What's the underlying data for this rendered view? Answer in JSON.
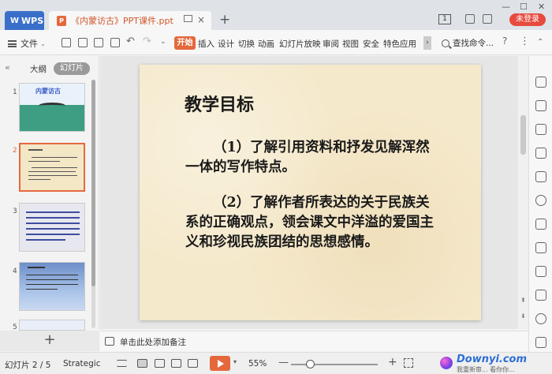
{
  "titlebar": {
    "app_tab": "WPS",
    "doc_title": "《内蒙访古》PPT课件.ppt",
    "badge": "1",
    "login": "未登录"
  },
  "ribbon": {
    "file": "文件",
    "start": "开始",
    "tabs": [
      "插入",
      "设计",
      "切换",
      "动画",
      "幻灯片放映",
      "审阅",
      "视图",
      "安全",
      "特色应用"
    ],
    "search": "查找命令..."
  },
  "left_panel": {
    "outline_tab": "大纲",
    "slides_tab": "幻灯片",
    "thumbnails": [
      {
        "num": "1",
        "title": "内蒙访古"
      },
      {
        "num": "2"
      },
      {
        "num": "3"
      },
      {
        "num": "4"
      },
      {
        "num": "5"
      }
    ],
    "add": "+"
  },
  "slide": {
    "title": "教学目标",
    "paragraphs": [
      "（1）了解引用资料和抒发见解浑然一体的写作特点。",
      "（2）了解作者所表达的关于民族关系的正确观点，领会课文中洋溢的爱国主义和珍视民族团结的思想感情。"
    ]
  },
  "notes": {
    "placeholder": "单击此处添加备注"
  },
  "status": {
    "page": "幻灯片 2 / 5",
    "theme": "Strategic",
    "zoom": "55%",
    "zoom_level": 0.22
  },
  "watermark": {
    "brand": "Downyi.com",
    "sub": "我重新审... 看你你..."
  },
  "colors": {
    "accent": "#e5683d",
    "wps_blue": "#3a6fc9",
    "login_red": "#e84a3e",
    "slide_bg": "#f5e9cb"
  }
}
